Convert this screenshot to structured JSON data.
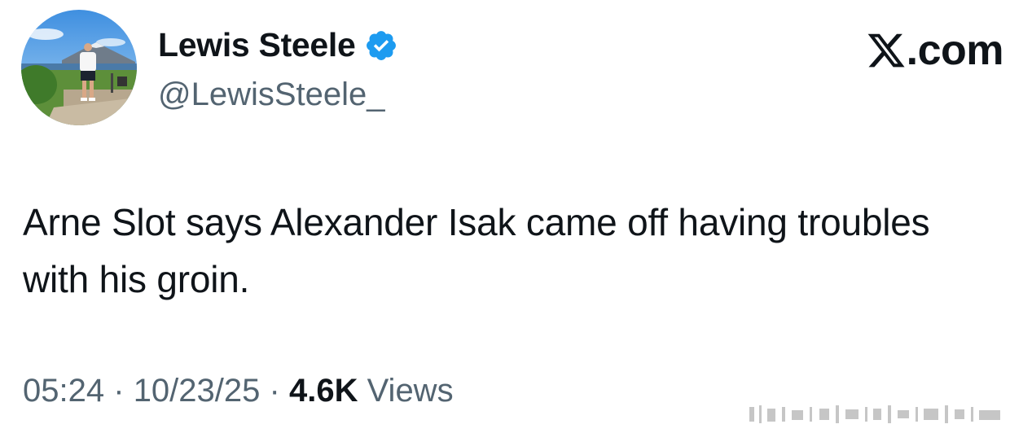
{
  "author": {
    "display_name": "Lewis Steele",
    "handle": "@LewisSteele_",
    "verified": true
  },
  "brand": {
    "label": ".com",
    "icon": "x-logo-icon"
  },
  "tweet": {
    "text": "Arne Slot says Alexander Isak came off having troubles with his groin."
  },
  "meta": {
    "time": "05:24",
    "separator": "·",
    "date": "10/23/25",
    "views_count": "4.6K",
    "views_label": "Views"
  },
  "colors": {
    "text": "#0f1419",
    "secondary": "#536471",
    "verified_badge": "#1d9bf0"
  }
}
